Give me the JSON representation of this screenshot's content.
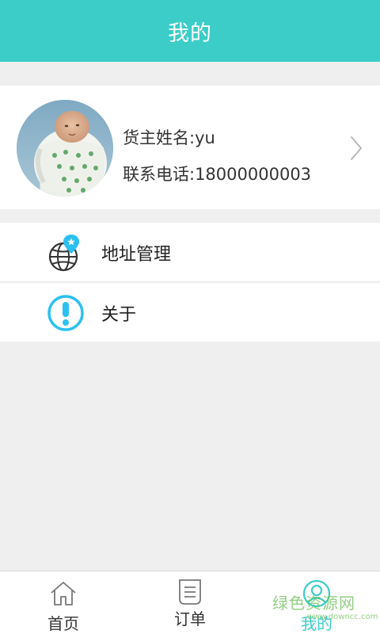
{
  "header": {
    "title": "我的"
  },
  "profile": {
    "name_line": "货主姓名:yu",
    "phone_line": "联系电话:18000000003"
  },
  "menu": {
    "items": [
      {
        "label": "地址管理",
        "icon": "location-globe-icon"
      },
      {
        "label": "关于",
        "icon": "info-exclamation-icon"
      }
    ]
  },
  "tabbar": {
    "tabs": [
      {
        "label": "首页",
        "icon": "home-icon",
        "active": false
      },
      {
        "label": "订单",
        "icon": "order-list-icon",
        "active": false
      },
      {
        "label": "我的",
        "icon": "user-icon",
        "active": true
      }
    ]
  },
  "colors": {
    "accent": "#3dcdc8",
    "background": "#efefef"
  },
  "watermark": {
    "text": "绿色资源网",
    "url": "www.downcc.com"
  }
}
